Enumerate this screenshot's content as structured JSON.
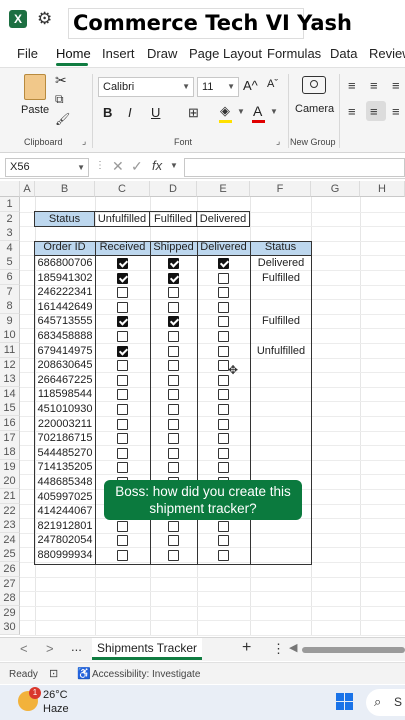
{
  "title_banner": "Commerce Tech VI Yash",
  "menu": {
    "tabs": [
      "File",
      "Home",
      "Insert",
      "Draw",
      "Page Layout",
      "Formulas",
      "Data",
      "Review"
    ],
    "active": "Home"
  },
  "ribbon": {
    "paste_label": "Paste",
    "clipboard_label": "Clipboard",
    "font_name": "Calibri",
    "font_size": "11",
    "font_group_label": "Font",
    "camera_label": "Camera",
    "new_group_label": "New Group",
    "bold": "B",
    "italic": "I",
    "underline": "U",
    "grow_font": "A^",
    "shrink_font": "Aˇ"
  },
  "formula_bar": {
    "name_box": "X56",
    "fx": "fx",
    "value": ""
  },
  "columns": [
    "A",
    "B",
    "C",
    "D",
    "E",
    "F",
    "G",
    "H"
  ],
  "rows": [
    "1",
    "2",
    "3",
    "4",
    "5",
    "6",
    "7",
    "8",
    "9",
    "10",
    "11",
    "12",
    "13",
    "14",
    "15",
    "16",
    "17",
    "18",
    "19",
    "20",
    "21",
    "22",
    "23",
    "24",
    "25",
    "26",
    "27",
    "28",
    "29",
    "30"
  ],
  "status_summary": {
    "header": "Status",
    "labels": [
      "Unfulfilled",
      "Fulfilled",
      "Delivered"
    ]
  },
  "table": {
    "headers": [
      "Order ID",
      "Received",
      "Shipped",
      "Delivered",
      "Status"
    ],
    "rows": [
      {
        "order_id": "686800706",
        "received": true,
        "shipped": true,
        "delivered": true,
        "status": "Delivered"
      },
      {
        "order_id": "185941302",
        "received": true,
        "shipped": true,
        "delivered": false,
        "status": "Fulfilled"
      },
      {
        "order_id": "246222341",
        "received": false,
        "shipped": false,
        "delivered": false,
        "status": ""
      },
      {
        "order_id": "161442649",
        "received": false,
        "shipped": false,
        "delivered": false,
        "status": ""
      },
      {
        "order_id": "645713555",
        "received": true,
        "shipped": true,
        "delivered": false,
        "status": "Fulfilled"
      },
      {
        "order_id": "683458888",
        "received": false,
        "shipped": false,
        "delivered": false,
        "status": ""
      },
      {
        "order_id": "679414975",
        "received": true,
        "shipped": false,
        "delivered": false,
        "status": "Unfulfilled"
      },
      {
        "order_id": "208630645",
        "received": false,
        "shipped": false,
        "delivered": false,
        "status": ""
      },
      {
        "order_id": "266467225",
        "received": false,
        "shipped": false,
        "delivered": false,
        "status": ""
      },
      {
        "order_id": "118598544",
        "received": false,
        "shipped": false,
        "delivered": false,
        "status": ""
      },
      {
        "order_id": "451010930",
        "received": false,
        "shipped": false,
        "delivered": false,
        "status": ""
      },
      {
        "order_id": "220003211",
        "received": false,
        "shipped": false,
        "delivered": false,
        "status": ""
      },
      {
        "order_id": "702186715",
        "received": false,
        "shipped": false,
        "delivered": false,
        "status": ""
      },
      {
        "order_id": "544485270",
        "received": false,
        "shipped": false,
        "delivered": false,
        "status": ""
      },
      {
        "order_id": "714135205",
        "received": false,
        "shipped": false,
        "delivered": false,
        "status": ""
      },
      {
        "order_id": "448685348",
        "received": false,
        "shipped": false,
        "delivered": false,
        "status": ""
      },
      {
        "order_id": "405997025",
        "received": false,
        "shipped": false,
        "delivered": false,
        "status": ""
      },
      {
        "order_id": "414244067",
        "received": false,
        "shipped": false,
        "delivered": false,
        "status": ""
      },
      {
        "order_id": "821912801",
        "received": false,
        "shipped": false,
        "delivered": false,
        "status": ""
      },
      {
        "order_id": "247802054",
        "received": false,
        "shipped": false,
        "delivered": false,
        "status": ""
      },
      {
        "order_id": "880999934",
        "received": false,
        "shipped": false,
        "delivered": false,
        "status": ""
      }
    ]
  },
  "caption": "Boss: how did you create this shipment tracker?",
  "sheet_tabs": {
    "active": "Shipments Tracker",
    "nav_prev": "<",
    "nav_next": ">",
    "more": "...",
    "add": "+",
    "options": "⋮"
  },
  "status_bar": {
    "ready": "Ready",
    "accessibility": "Accessibility: Investigate"
  },
  "taskbar": {
    "weather_badge": "1",
    "temperature": "26°C",
    "condition": "Haze",
    "search_partial": "S"
  },
  "colors": {
    "excel_green": "#107c41",
    "header_fill": "#bdd7ee",
    "caption_bg": "#0b7a3e"
  }
}
